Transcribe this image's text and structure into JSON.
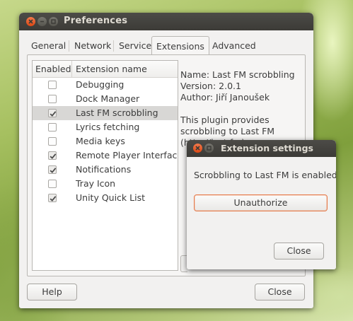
{
  "preferences_window": {
    "title": "Preferences",
    "tabs": [
      {
        "label": "General"
      },
      {
        "label": "Network"
      },
      {
        "label": "Service"
      },
      {
        "label": "Extensions",
        "active": true
      },
      {
        "label": "Advanced"
      }
    ],
    "extension_list": {
      "header_enabled": "Enabled",
      "header_name": "Extension name",
      "items": [
        {
          "name": "Debugging",
          "enabled": false
        },
        {
          "name": "Dock Manager",
          "enabled": false
        },
        {
          "name": "Last FM scrobbling",
          "enabled": true,
          "selected": true
        },
        {
          "name": "Lyrics fetching",
          "enabled": false
        },
        {
          "name": "Media keys",
          "enabled": false
        },
        {
          "name": "Remote Player Interface",
          "enabled": true
        },
        {
          "name": "Notifications",
          "enabled": true
        },
        {
          "name": "Tray Icon",
          "enabled": false
        },
        {
          "name": "Unity Quick List",
          "enabled": true
        }
      ]
    },
    "extension_info": {
      "name_line": "Name: Last FM scrobbling",
      "version_line": "Version: 2.0.1",
      "author_line": "Author: Jiří Janoušek",
      "description": "This plugin provides scrobbling to Last FM (http://last.fm)"
    },
    "help_button": "Help",
    "close_button": "Close"
  },
  "settings_dialog": {
    "title": "Extension settings",
    "message": "Scrobbling to Last FM is enabled.",
    "unauthorize_button": "Unauthorize",
    "close_button": "Close"
  },
  "colors": {
    "titlebar": "#3c3b37",
    "close_button": "#dd4814",
    "window_bg": "#f2f1f0",
    "selected_row": "#d8d7d5"
  },
  "icons": {
    "window_close": "close-icon",
    "window_minimize": "minimize-icon",
    "window_maximize": "maximize-icon",
    "checkbox_checked": "checkmark-icon"
  }
}
